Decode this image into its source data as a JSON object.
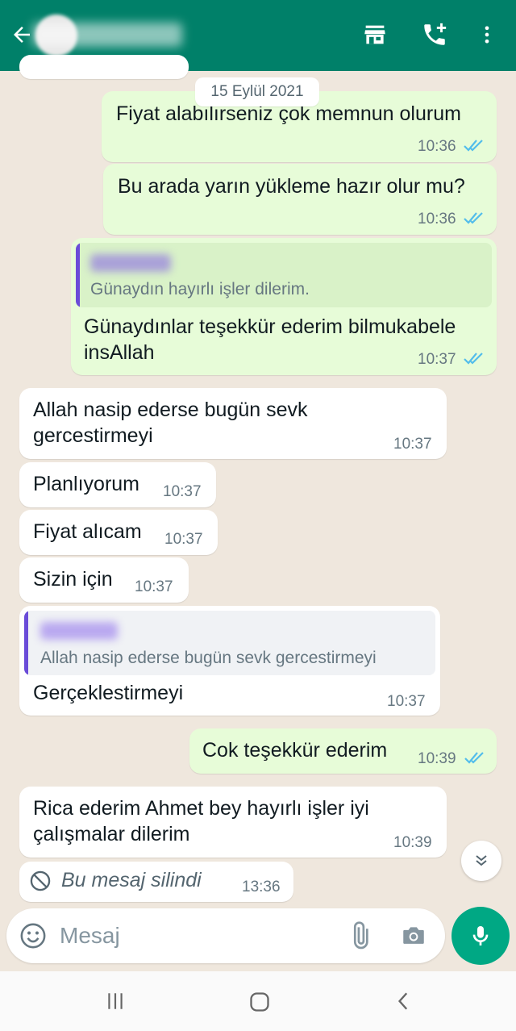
{
  "header": {
    "contact_name": "",
    "icons": [
      "back-arrow-icon",
      "shop-icon",
      "add-call-icon",
      "more-vert-icon"
    ]
  },
  "chat": {
    "date_chip": "15 Eylül 2021",
    "messages": [
      {
        "direction": "outgoing",
        "text": "Fiyat alabılırseniz çok memnun olurum",
        "time": "10:36",
        "status": "read"
      },
      {
        "direction": "outgoing",
        "text": "Bu arada  yarın yükleme hazır olur mu?",
        "time": "10:36",
        "status": "read"
      },
      {
        "direction": "outgoing",
        "reply_to": {
          "text": "Günaydın hayırlı işler dilerim."
        },
        "lines": [
          "Günaydınlar  teşekkür ederim bilmukabele",
          "insAllah"
        ],
        "time": "10:37",
        "status": "read"
      },
      {
        "direction": "incoming",
        "lines": [
          "Allah nasip ederse bugün sevk",
          "gercestirmeyi"
        ],
        "time": "10:37"
      },
      {
        "direction": "incoming",
        "text": "Planlıyorum",
        "time": "10:37"
      },
      {
        "direction": "incoming",
        "text": "Fiyat alıcam",
        "time": "10:37"
      },
      {
        "direction": "incoming",
        "text": "Sizin için",
        "time": "10:37"
      },
      {
        "direction": "incoming",
        "reply_to": {
          "text": "Allah nasip ederse bugün sevk gercestirmeyi"
        },
        "text": "Gerçeklestirmeyi",
        "time": "10:37"
      },
      {
        "direction": "outgoing",
        "text": "Cok teşekkür   ederim",
        "time": "10:39",
        "status": "read"
      },
      {
        "direction": "incoming",
        "lines": [
          "Rica ederim Ahmet bey hayırlı işler iyi",
          "çalışmalar dilerim"
        ],
        "time": "10:39"
      },
      {
        "direction": "incoming",
        "deleted": true,
        "text": "Bu mesaj silindi",
        "time": "13:36"
      }
    ]
  },
  "composer": {
    "placeholder": "Mesaj",
    "icons": [
      "emoji-icon",
      "attach-icon",
      "camera-icon",
      "mic-icon"
    ]
  },
  "colors": {
    "header": "#008069",
    "outgoing_bubble": "#e7fcd8",
    "incoming_bubble": "#ffffff",
    "chat_background": "#efe7dd",
    "read_ticks": "#53bdeb",
    "mic_button": "#00a884",
    "reply_bar": "#6a4cd8"
  }
}
